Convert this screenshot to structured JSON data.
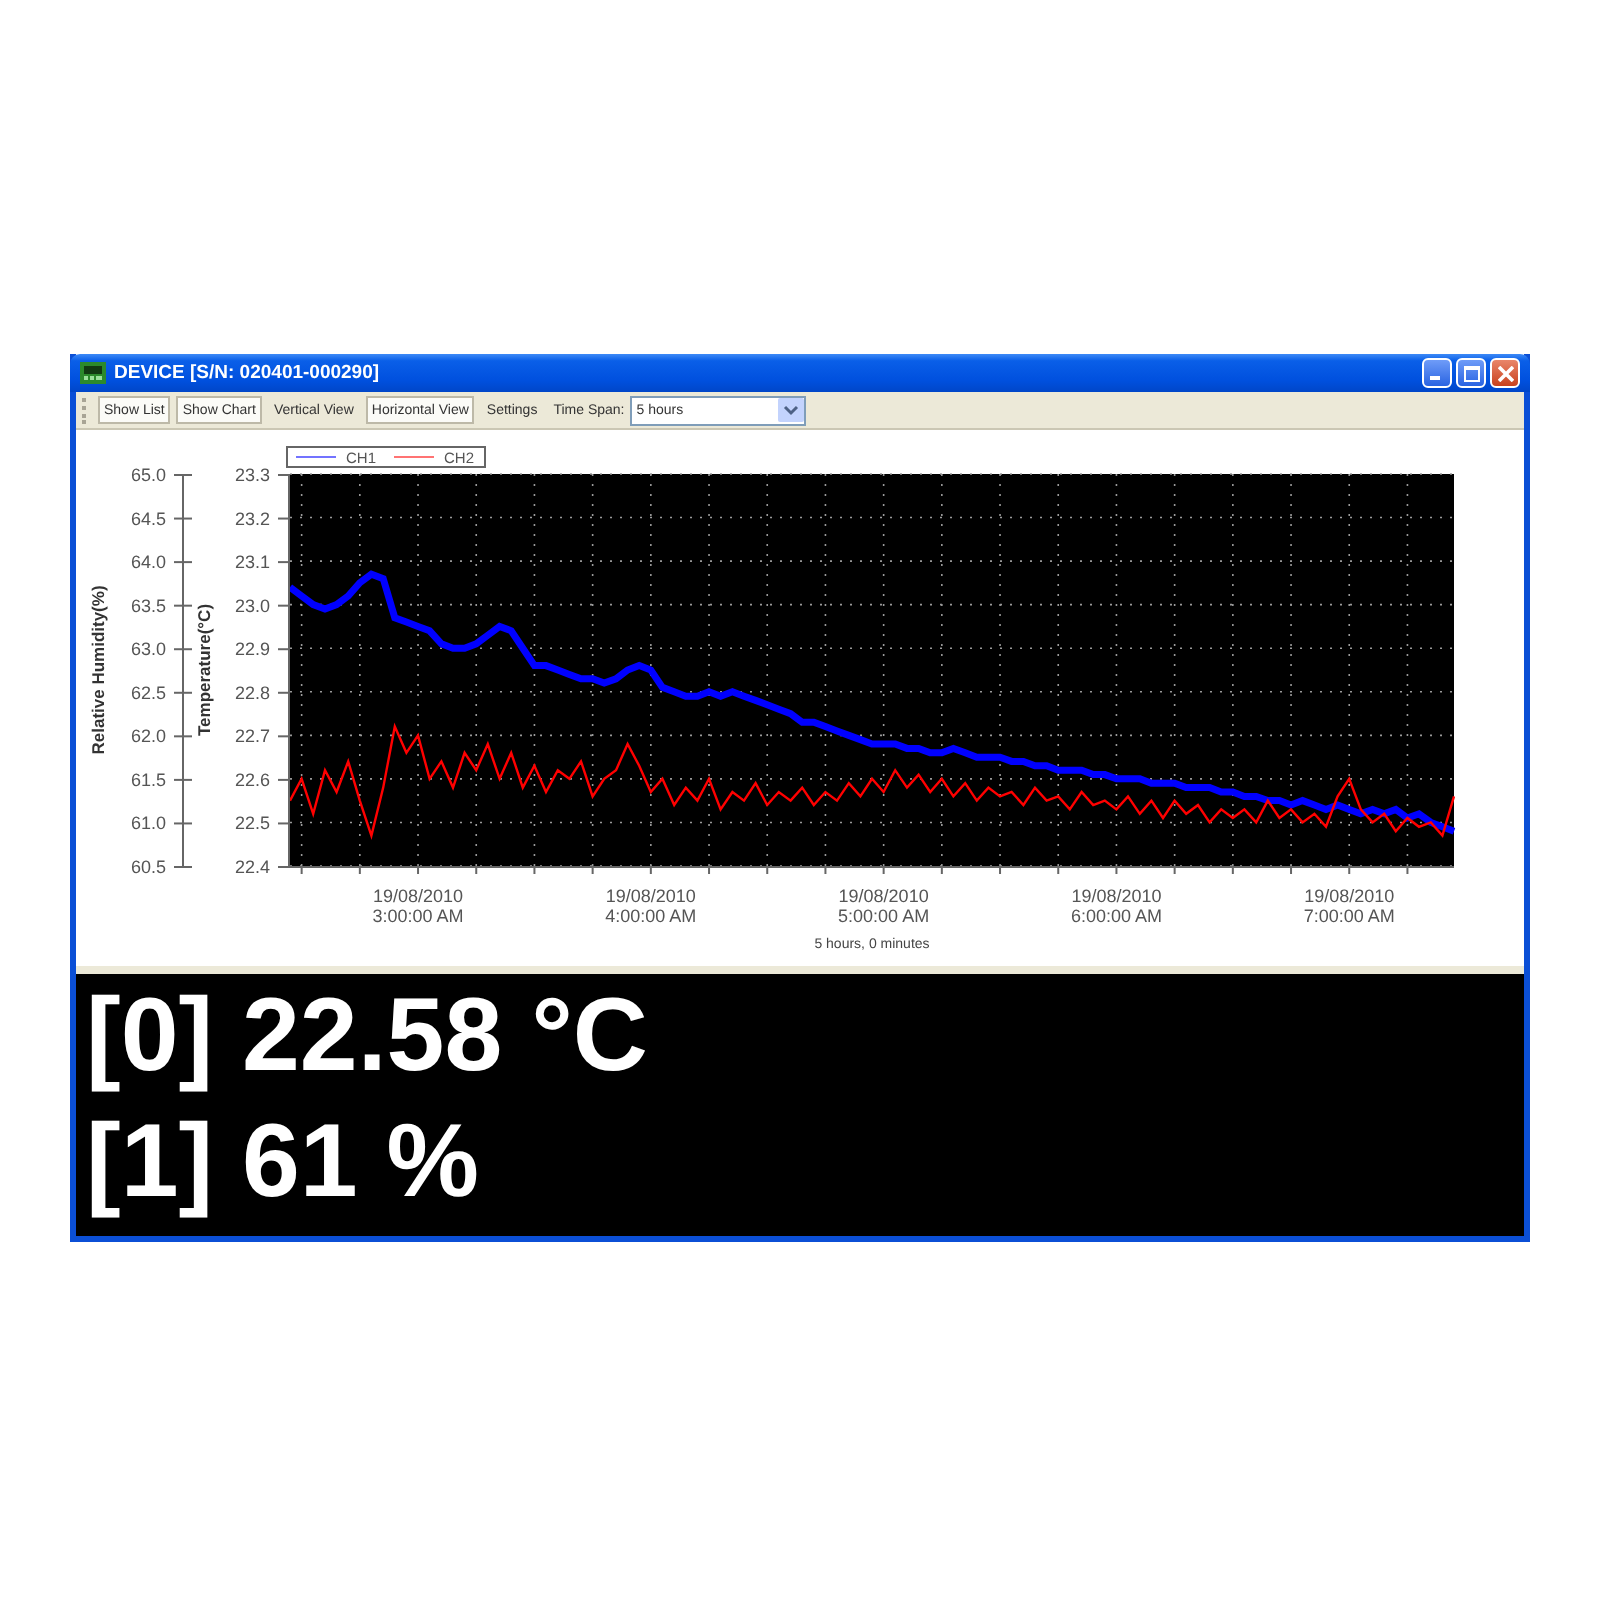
{
  "window": {
    "title": "DEVICE [S/N: 020401-000290]"
  },
  "toolbar": {
    "items": [
      {
        "kind": "button",
        "label": "Show List",
        "pressed": true
      },
      {
        "kind": "button",
        "label": "Show Chart",
        "pressed": true
      },
      {
        "kind": "button",
        "label": "Vertical View",
        "pressed": false
      },
      {
        "kind": "button",
        "label": "Horizontal View",
        "pressed": true
      },
      {
        "kind": "button",
        "label": "Settings",
        "pressed": false
      },
      {
        "kind": "label",
        "label": "Time Span:"
      },
      {
        "kind": "dropdown",
        "value": "5 hours"
      }
    ]
  },
  "chart": {
    "secondary_axis": {
      "title": "Relative Humidity(%)",
      "ticks": [
        "65.0",
        "64.5",
        "64.0",
        "63.5",
        "63.0",
        "62.5",
        "62.0",
        "61.5",
        "61.0",
        "60.5"
      ]
    },
    "chart_data": {
      "type": "line",
      "xlabel": "5 hours, 0 minutes",
      "ylabel": "Temperature(°C)",
      "ylim": [
        22.4,
        23.3
      ],
      "grid": true,
      "legend": true,
      "categories": [
        null,
        null,
        null,
        null,
        null,
        null,
        null,
        null,
        null,
        null,
        null,
        "19/08/2010 3:00:00 AM",
        null,
        null,
        null,
        null,
        null,
        null,
        null,
        null,
        null,
        null,
        null,
        null,
        null,
        null,
        null,
        null,
        null,
        null,
        null,
        "19/08/2010 4:00:00 AM",
        null,
        null,
        null,
        null,
        null,
        null,
        null,
        null,
        null,
        null,
        null,
        null,
        null,
        null,
        null,
        null,
        null,
        null,
        null,
        "19/08/2010 5:00:00 AM",
        null,
        null,
        null,
        null,
        null,
        null,
        null,
        null,
        null,
        null,
        null,
        null,
        null,
        null,
        null,
        null,
        null,
        null,
        null,
        "19/08/2010 6:00:00 AM",
        null,
        null,
        null,
        null,
        null,
        null,
        null,
        null,
        null,
        null,
        null,
        null,
        null,
        null,
        null,
        null,
        null,
        null,
        null,
        "19/08/2010 7:00:00 AM",
        null,
        null,
        null,
        null,
        null,
        null,
        null,
        null,
        null
      ],
      "yticks": [
        {
          "value": 22.4,
          "label": "22.4"
        },
        {
          "value": 22.5,
          "label": "22.5"
        },
        {
          "value": 22.6,
          "label": "22.6"
        },
        {
          "value": 22.7,
          "label": "22.7"
        },
        {
          "value": 22.8,
          "label": "22.8"
        },
        {
          "value": 22.9,
          "label": "22.9"
        },
        {
          "value": 23.0,
          "label": "23.0"
        },
        {
          "value": 23.1,
          "label": "23.1"
        },
        {
          "value": 23.2,
          "label": "23.2"
        },
        {
          "value": 23.3,
          "label": "23.3"
        }
      ],
      "series": [
        {
          "name": "CH1",
          "color": "#0000ff",
          "values": [
            23.04,
            23.02,
            23.0,
            22.99,
            23.0,
            23.02,
            23.05,
            23.07,
            23.06,
            22.97,
            22.96,
            22.95,
            22.94,
            22.91,
            22.9,
            22.9,
            22.91,
            22.93,
            22.95,
            22.94,
            22.9,
            22.86,
            22.86,
            22.85,
            22.84,
            22.83,
            22.83,
            22.82,
            22.83,
            22.85,
            22.86,
            22.85,
            22.81,
            22.8,
            22.79,
            22.79,
            22.8,
            22.79,
            22.8,
            22.79,
            22.78,
            22.77,
            22.76,
            22.75,
            22.73,
            22.73,
            22.72,
            22.71,
            22.7,
            22.69,
            22.68,
            22.68,
            22.68,
            22.67,
            22.67,
            22.66,
            22.66,
            22.67,
            22.66,
            22.65,
            22.65,
            22.65,
            22.64,
            22.64,
            22.63,
            22.63,
            22.62,
            22.62,
            22.62,
            22.61,
            22.61,
            22.6,
            22.6,
            22.6,
            22.59,
            22.59,
            22.59,
            22.58,
            22.58,
            22.58,
            22.57,
            22.57,
            22.56,
            22.56,
            22.55,
            22.55,
            22.54,
            22.55,
            22.54,
            22.53,
            22.54,
            22.53,
            22.52,
            22.53,
            22.52,
            22.53,
            22.51,
            22.52,
            22.5,
            22.49,
            22.48
          ]
        },
        {
          "name": "CH2",
          "color": "#ff0000",
          "values": [
            22.55,
            22.6,
            22.52,
            22.62,
            22.57,
            22.64,
            22.55,
            22.47,
            22.58,
            22.72,
            22.66,
            22.7,
            22.6,
            22.64,
            22.58,
            22.66,
            22.62,
            22.68,
            22.6,
            22.66,
            22.58,
            22.63,
            22.57,
            22.62,
            22.6,
            22.64,
            22.56,
            22.6,
            22.62,
            22.68,
            22.63,
            22.57,
            22.6,
            22.54,
            22.58,
            22.55,
            22.6,
            22.53,
            22.57,
            22.55,
            22.59,
            22.54,
            22.57,
            22.55,
            22.58,
            22.54,
            22.57,
            22.55,
            22.59,
            22.56,
            22.6,
            22.57,
            22.62,
            22.58,
            22.61,
            22.57,
            22.6,
            22.56,
            22.59,
            22.55,
            22.58,
            22.56,
            22.57,
            22.54,
            22.58,
            22.55,
            22.56,
            22.53,
            22.57,
            22.54,
            22.55,
            22.53,
            22.56,
            22.52,
            22.55,
            22.51,
            22.55,
            22.52,
            22.54,
            22.5,
            22.53,
            22.51,
            22.53,
            22.5,
            22.55,
            22.51,
            22.53,
            22.5,
            22.52,
            22.49,
            22.56,
            22.6,
            22.53,
            22.5,
            22.52,
            22.48,
            22.51,
            22.49,
            22.5,
            22.47,
            22.56
          ]
        }
      ]
    }
  },
  "readouts": [
    "[0] 22.58 °C",
    "[1] 61 %"
  ]
}
